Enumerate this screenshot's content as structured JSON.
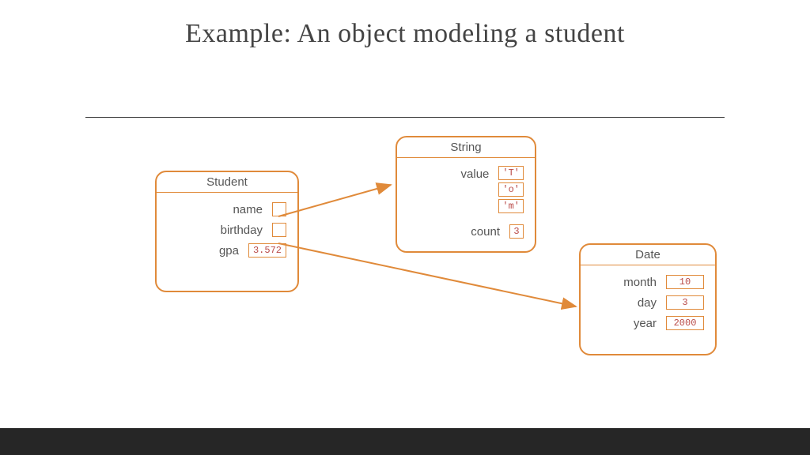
{
  "title": "Example: An object modeling a student",
  "objects": {
    "student": {
      "header": "Student",
      "fields": {
        "name": {
          "label": "name"
        },
        "birthday": {
          "label": "birthday"
        },
        "gpa": {
          "label": "gpa",
          "value": "3.572"
        }
      }
    },
    "string": {
      "header": "String",
      "fields": {
        "value": {
          "label": "value",
          "chars": [
            "'T'",
            "'o'",
            "'m'"
          ]
        },
        "count": {
          "label": "count",
          "value": "3"
        }
      }
    },
    "date": {
      "header": "Date",
      "fields": {
        "month": {
          "label": "month",
          "value": "10"
        },
        "day": {
          "label": "day",
          "value": "3"
        },
        "year": {
          "label": "year",
          "value": "2000"
        }
      }
    }
  }
}
